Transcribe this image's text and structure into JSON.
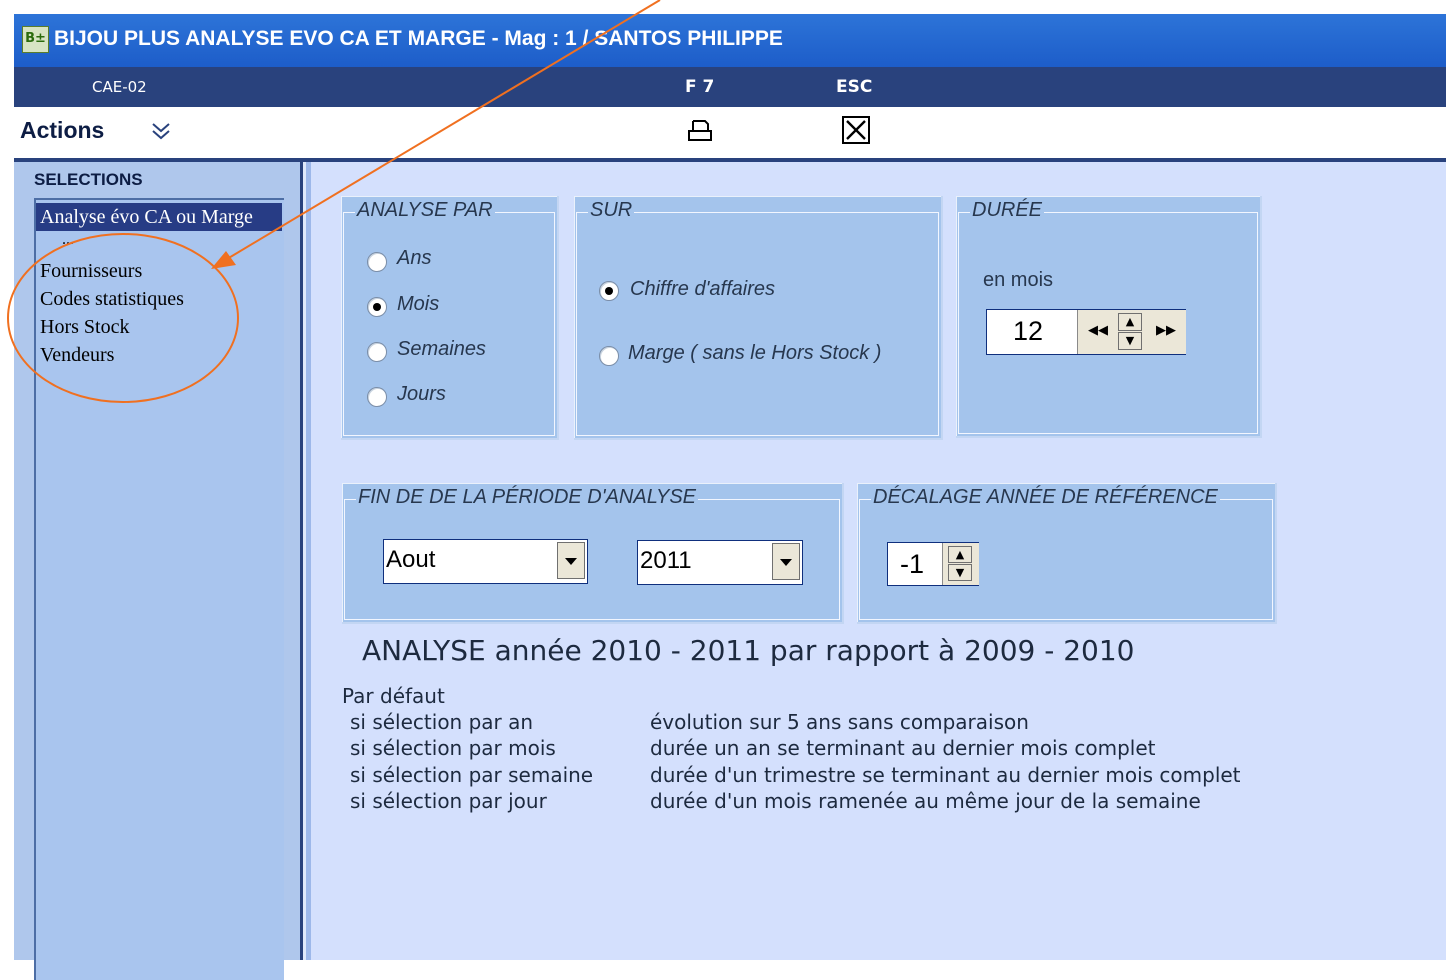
{
  "window": {
    "app_icon": "B±",
    "title": "BIJOU PLUS ANALYSE EVO CA ET MARGE  - Mag : 1 / SANTOS PHILIPPE"
  },
  "infobar": {
    "screen_code": "CAE-02",
    "print_key": "F 7",
    "exit_key": "ESC"
  },
  "toolbar": {
    "actions_label": "Actions",
    "chevron": "≫",
    "print_icon": "printer-icon",
    "close_icon": "close-box-icon"
  },
  "sidebar": {
    "heading": "SELECTIONS",
    "items": [
      "Analyse évo CA ou Marge",
      "...",
      "Fournisseurs",
      "Codes statistiques",
      "Hors Stock",
      "Vendeurs"
    ],
    "selected_index": 0
  },
  "analyse_par": {
    "legend": "ANALYSE PAR",
    "options": [
      "Ans",
      "Mois",
      "Semaines",
      "Jours"
    ],
    "selected": "Mois"
  },
  "sur": {
    "legend": "SUR",
    "options": [
      "Chiffre d'affaires",
      "Marge ( sans le Hors Stock )"
    ],
    "selected": "Chiffre d'affaires"
  },
  "duree": {
    "legend": "DURÉE",
    "label": "en mois",
    "value": "12"
  },
  "fin_periode": {
    "legend": "FIN DE DE LA PÉRIODE  D'ANALYSE",
    "month": "Aout",
    "year": "2011"
  },
  "decalage": {
    "legend": "DÉCALAGE ANNÉE DE RÉFÉRENCE",
    "value": "-1"
  },
  "summary": "ANALYSE année 2010 - 2011 par rapport à 2009 - 2010",
  "defaults": {
    "heading": "Par défaut",
    "rows": [
      {
        "condition": "si sélection par an",
        "description": "évolution sur 5 ans sans comparaison"
      },
      {
        "condition": "si sélection par mois",
        "description": "durée  un an  se terminant au dernier mois complet"
      },
      {
        "condition": "si sélection par semaine",
        "description": "durée d'un trimestre se terminant au dernier mois complet"
      },
      {
        "condition": "si sélection par jour",
        "description": "durée d'un mois ramenée au même jour de la semaine"
      }
    ]
  },
  "colors": {
    "titlebar": "#1d5dc9",
    "infobar": "#29427d",
    "group_bg": "#a4c4ec",
    "annotation": "#f07020"
  }
}
